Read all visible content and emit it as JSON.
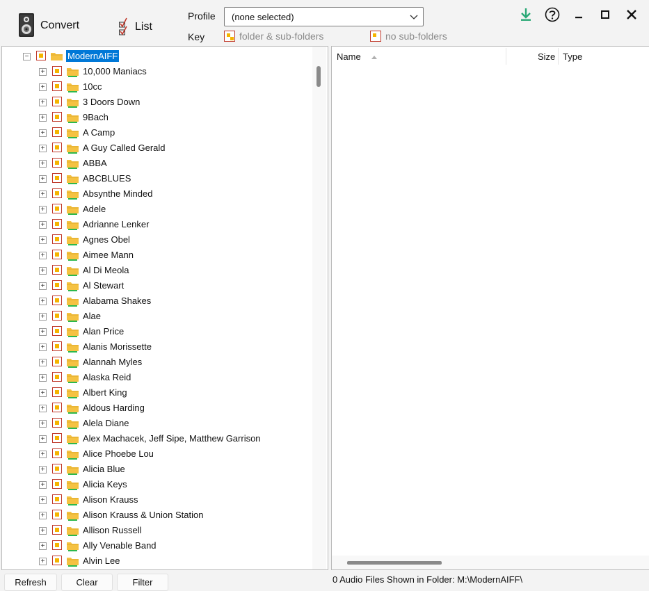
{
  "toolbar": {
    "convert_label": "Convert",
    "list_label": "List",
    "profile_label": "Profile",
    "profile_value": "(none selected)",
    "key_label": "Key",
    "key_subfolders_label": "folder & sub-folders",
    "key_nosub_label": "no sub-folders"
  },
  "tree": {
    "root": "ModernAIFF",
    "items": [
      "10,000 Maniacs",
      "10cc",
      "3 Doors Down",
      "9Bach",
      "A Camp",
      "A Guy Called Gerald",
      "ABBA",
      "ABCBLUES",
      "Absynthe Minded",
      "Adele",
      "Adrianne Lenker",
      "Agnes Obel",
      "Aimee Mann",
      "Al Di Meola",
      "Al Stewart",
      "Alabama Shakes",
      "Alae",
      "Alan Price",
      "Alanis Morissette",
      "Alannah Myles",
      "Alaska Reid",
      "Albert King",
      "Aldous Harding",
      "Alela Diane",
      "Alex Machacek, Jeff Sipe, Matthew Garrison",
      "Alice Phoebe Lou",
      "Alicia Blue",
      "Alicia Keys",
      "Alison Krauss",
      "Alison Krauss & Union Station",
      "Allison Russell",
      "Ally Venable Band",
      "Alvin Lee"
    ]
  },
  "list": {
    "columns": {
      "name": "Name",
      "size": "Size",
      "type": "Type"
    }
  },
  "bottom": {
    "refresh_label": "Refresh",
    "clear_label": "Clear",
    "filter_label": "Filter",
    "status": "0 Audio Files Shown in Folder: M:\\ModernAIFF\\"
  },
  "colors": {
    "selection": "#0078d7",
    "folder": "#f5c242",
    "folder_strip": "#2db84d",
    "check_border": "#c0392b",
    "check_fill": "#f5b400",
    "download_icon": "#2aa876"
  }
}
